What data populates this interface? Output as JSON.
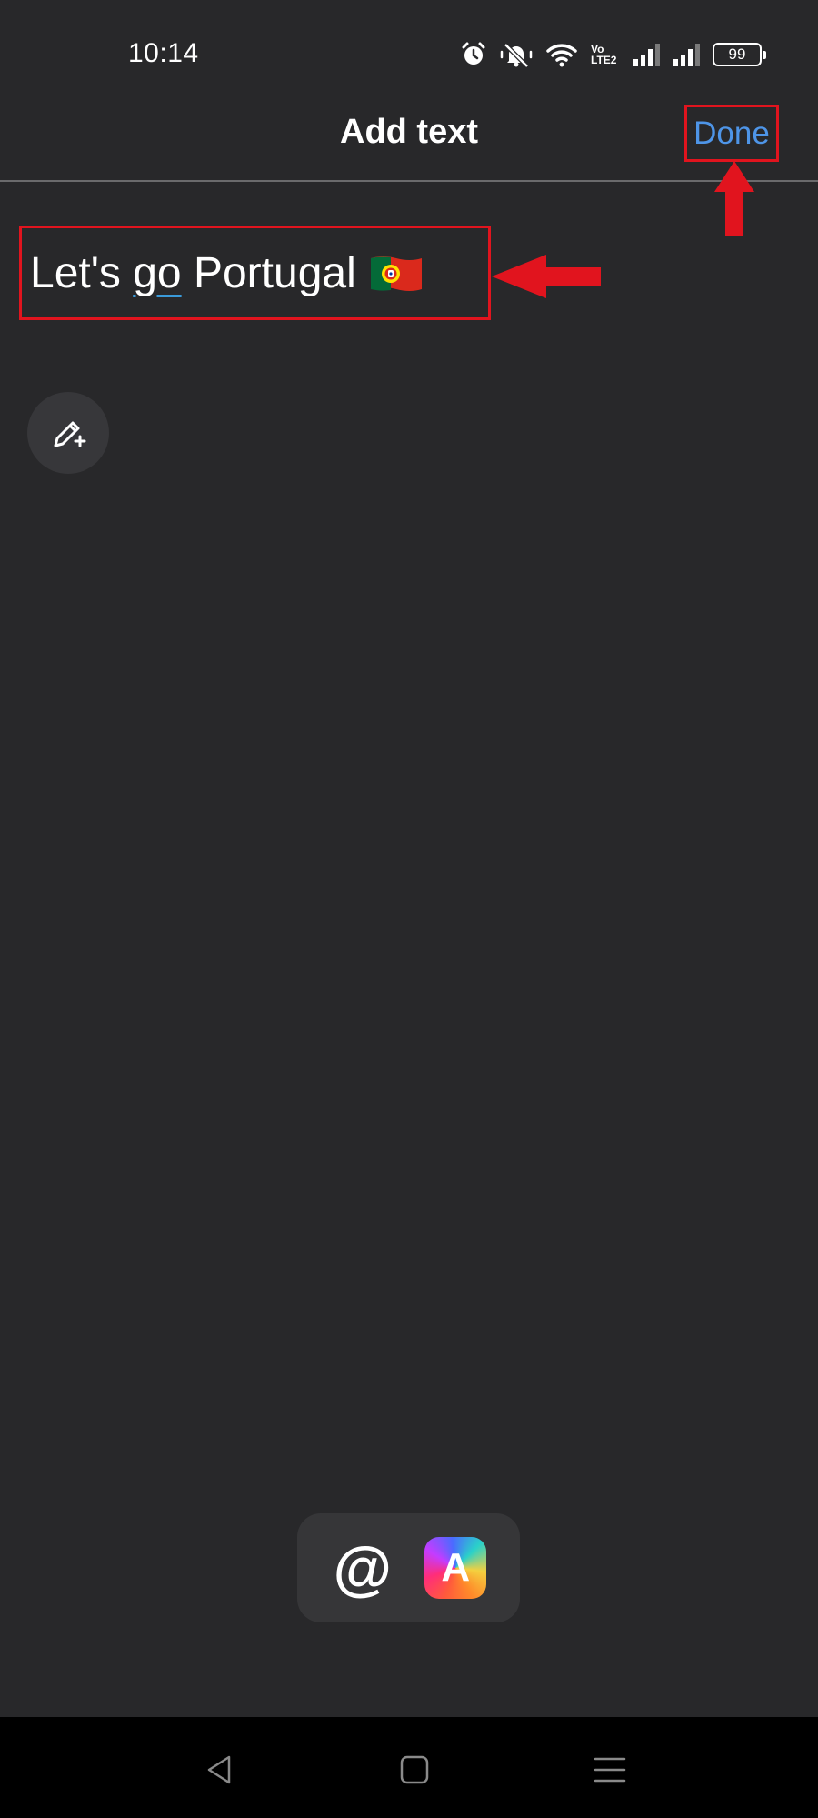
{
  "status_bar": {
    "time": "10:14",
    "icons": [
      "alarm-icon",
      "mute-icon",
      "wifi-icon",
      "volte-icon",
      "signal-icon",
      "signal-icon",
      "battery-icon"
    ],
    "volte_top": "Vo",
    "volte_bottom": "LTE2",
    "battery_level": "99"
  },
  "header": {
    "title": "Add text",
    "done_label": "Done"
  },
  "editor": {
    "text_before": "Let's ",
    "text_underlined": "go",
    "text_after": " Portugal",
    "emoji": "portugal-flag-emoji"
  },
  "tools": {
    "pencil_icon": "pencil-sparkle-icon"
  },
  "bottom_toolbar": {
    "mention_label": "@",
    "font_style_label": "A"
  },
  "nav_bar": {
    "items": [
      "back-icon",
      "home-icon",
      "menu-icon"
    ]
  },
  "colors": {
    "background": "#28282a",
    "accent_blue": "#4e95e8",
    "annotation_red": "#e1141e",
    "nav_bar": "#000000"
  }
}
